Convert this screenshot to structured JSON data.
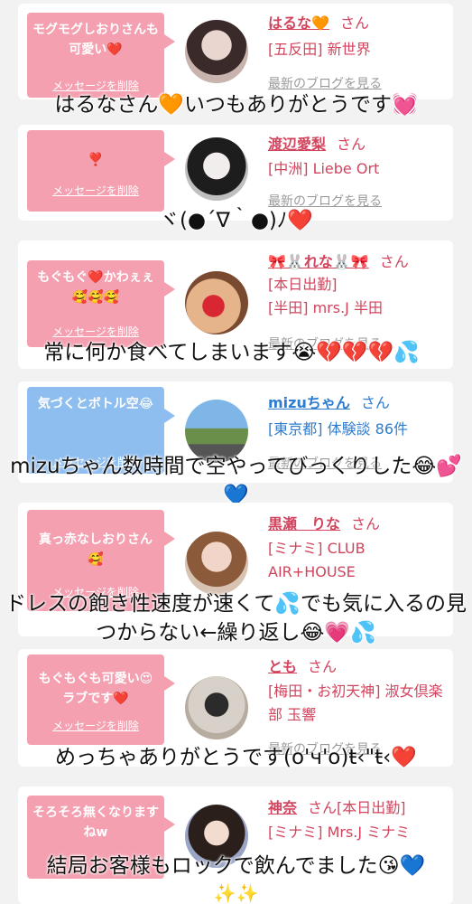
{
  "delete_label": "メッセージを削除",
  "blog_label": "最新のブログを見る",
  "san": "さん",
  "entries": [
    {
      "message": "モグモグしおりさんも可愛い❤️",
      "name": "はるな🧡",
      "shop": "[五反田] 新世界",
      "overlay": "はるなさん🧡いつもありがとうです💓"
    },
    {
      "message": "❣️",
      "name": "渡辺愛梨",
      "shop": "[中洲] Liebe Ort",
      "overlay": "ヾ(●´∇｀●)ﾉ❤️"
    },
    {
      "message": "もぐもぐ❤️かわぇぇ🥰🥰🥰",
      "name": "🎀🐰れな🐰🎀",
      "shop": "[本日出勤]\n[半田] mrs.J 半田",
      "overlay": "常に何か食べてしまいます😭💔💔💔💦"
    },
    {
      "message": "気づくとボトル空😂",
      "name": "mizuちゃん",
      "shop": "[東京都] 体験談 86件",
      "overlay": "mizuちゃん数時間で空やってびっくりした😂💕💙"
    },
    {
      "message": "真っ赤なしおりさん🥰",
      "name": "黒瀬　りな",
      "shop": "[ミナミ] CLUB AIR+HOUSE",
      "overlay": "ドレスの飽き性速度が速くて💦でも気に入るの見つからない←繰り返し😂💗💦"
    },
    {
      "message": "もぐもぐも可愛い😍ラブです❤️",
      "name": "とも",
      "shop": "[梅田・お初天神] 淑女倶楽部 玉響",
      "overlay": "めっちゃありがとうです(o'ч'o)ŧ‹\"ŧ‹❤️"
    },
    {
      "message": "そろそろ無くなりますねw",
      "name": "神奈",
      "name_suffix": "[本日出勤]",
      "shop": "[ミナミ] Mrs.J ミナミ",
      "overlay": "結局お客様もロックで飲んでました😘💙",
      "overlay2": "✨✨"
    }
  ]
}
